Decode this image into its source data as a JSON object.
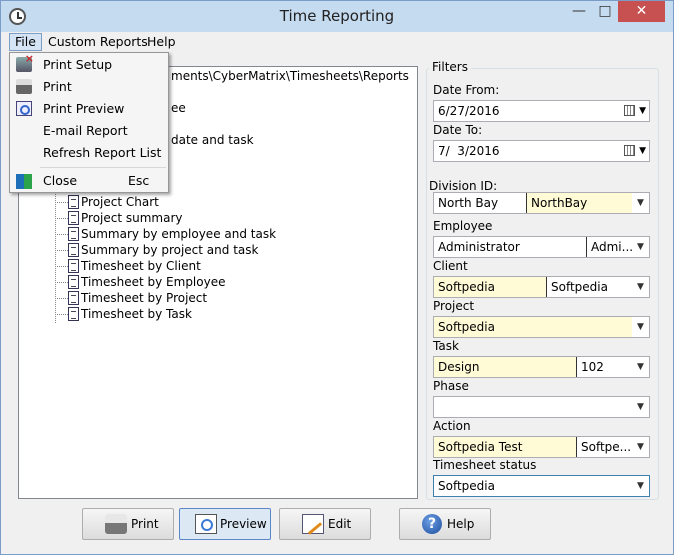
{
  "window": {
    "title": "Time Reporting"
  },
  "menu": {
    "file": "File",
    "custom_reports": "Custom Reports",
    "help": "Help"
  },
  "file_menu": {
    "print_setup": "Print Setup",
    "print": "Print",
    "print_preview": "Print Preview",
    "email_report": "E-mail Report",
    "refresh_report_list": "Refresh Report List",
    "close": "Close",
    "close_shortcut": "Esc"
  },
  "tree": {
    "root_path_fragment": "ments\\CyberMatrix\\Timesheets\\Reports",
    "hidden_fragment_1": "ee",
    "hidden_fragment_2": "date and task",
    "items": [
      "Project Chart",
      "Project summary",
      "Summary by employee and task",
      "Summary by project and task",
      "Timesheet by Client",
      "Timesheet by Employee",
      "Timesheet by Project",
      "Timesheet by Task"
    ]
  },
  "filters": {
    "title": "Filters",
    "date_from_label": "Date From:",
    "date_from": "6/27/2016",
    "date_to_label": "Date To:",
    "date_to": "7/  3/2016",
    "division_label": "Division ID:",
    "division_name": "North Bay",
    "division_id": "NorthBay",
    "employee_label": "Employee",
    "employee_name": "Administrator",
    "employee_id": "Admi...",
    "client_label": "Client",
    "client_name": "Softpedia",
    "client_id": "Softpedia",
    "project_label": "Project",
    "project": "Softpedia",
    "task_label": "Task",
    "task_name": "Design",
    "task_id": "102",
    "phase_label": "Phase",
    "phase": "",
    "action_label": "Action",
    "action_name": "Softpedia Test",
    "action_id": "Softpe...",
    "status_label": "Timesheet status",
    "status": "Softpedia"
  },
  "buttons": {
    "print": "Print",
    "preview": "Preview",
    "edit": "Edit",
    "help": "Help"
  }
}
